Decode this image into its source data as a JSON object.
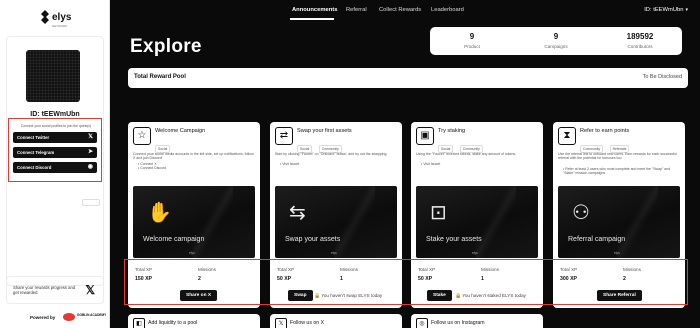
{
  "brand": {
    "name": "elys",
    "sub": "NETWORK"
  },
  "sidebar": {
    "user_id": "ID: tEEWmUbn",
    "connect_hint": "Connect your social profiles to join the quest(s)",
    "connect_buttons": [
      {
        "label": "Connect Twitter",
        "icon": "x-icon",
        "glyph": "𝕏"
      },
      {
        "label": "Connect Telegram",
        "icon": "telegram-icon",
        "glyph": "➤"
      },
      {
        "label": "Connect Discord",
        "icon": "discord-icon",
        "glyph": "◉"
      }
    ],
    "share_text": "Share your rewards progress and get rewarded",
    "powered_by": "Powered by",
    "powered_name": "GOBLIN ACADEMY"
  },
  "nav": {
    "items": [
      "Announcements",
      "Referral",
      "Collect Rewards",
      "Leaderboard"
    ],
    "user": "ID: tEEWmUbn"
  },
  "page": {
    "title": "Explore",
    "stats": [
      {
        "value": "9",
        "label": "Product"
      },
      {
        "value": "9",
        "label": "Campaigns"
      },
      {
        "value": "189592",
        "label": "Contributors"
      }
    ],
    "pool_label": "Total Reward Pool",
    "pool_value": "To Be Disclosed"
  },
  "cards": [
    {
      "title": "Welcome Campaign",
      "tags": [
        "Social"
      ],
      "desc": "Connect your social media accounts in the left side, set up notifications, follow X and join Discord!",
      "bullets": [
        "Connect X",
        "Connect Discord"
      ],
      "image_label": "Welcome campaign",
      "xp_label": "Total XP",
      "xp": "150 XP",
      "missions_label": "Missions",
      "missions": "2",
      "button": "Share on X",
      "note": ""
    },
    {
      "title": "Swap your first assets",
      "tags": [
        "Social",
        "Community"
      ],
      "desc": "Start by clicking \"Faucet\" on \"Onboard\" button, and try out the swapping.",
      "bullets": [
        "Visit faucet"
      ],
      "image_label": "Swap your assets",
      "xp_label": "Total XP",
      "xp": "50 XP",
      "missions_label": "Missions",
      "missions": "1",
      "button": "Swap",
      "note": "You haven't swap ELYS today"
    },
    {
      "title": "Try staking",
      "tags": [
        "Social",
        "Community"
      ],
      "desc": "Using the \"Faucet\" received tokens, stake any amount of tokens.",
      "bullets": [
        "Visit faucet"
      ],
      "image_label": "Stake your assets",
      "xp_label": "Total XP",
      "xp": "50 XP",
      "missions_label": "Missions",
      "missions": "1",
      "button": "Stake",
      "note": "You haven't staked ELYS today"
    },
    {
      "title": "Refer to earn points",
      "tags": [
        "Community",
        "Referrals"
      ],
      "desc": "Use the referral link to onboard new users. Earn rewards for each successful referral with the potential for bonuses too.",
      "bullets": [
        "Refer at least 2 users who must complete and meet the \"Swap\" and \"Stake\" mission campaigns"
      ],
      "image_label": "Referral campaign",
      "xp_label": "Total XP",
      "xp": "300 XP",
      "missions_label": "Missions",
      "missions": "2",
      "button": "Share Referral",
      "note": ""
    }
  ],
  "bottom_cards": [
    {
      "title": "Add liquidity to a pool"
    },
    {
      "title": "Follow us on X"
    },
    {
      "title": "Follow us on Instagram"
    }
  ]
}
